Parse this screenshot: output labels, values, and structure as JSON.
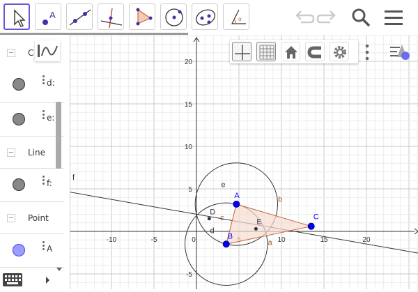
{
  "toolbar": {
    "tools": [
      {
        "name": "move-tool",
        "icon": "cursor-arrow-icon",
        "label_glyph": ""
      },
      {
        "name": "point-tool",
        "icon": "point-icon",
        "label_glyph": "A"
      },
      {
        "name": "line-tool",
        "icon": "line-through-points-icon",
        "label_glyph": ""
      },
      {
        "name": "perpendicular-line-tool",
        "icon": "perpendicular-line-icon",
        "label_glyph": ""
      },
      {
        "name": "polygon-tool",
        "icon": "polygon-icon",
        "label_glyph": ""
      },
      {
        "name": "circle-center-point-tool",
        "icon": "circle-icon",
        "label_glyph": ""
      },
      {
        "name": "conic-tool",
        "icon": "ellipse-icon",
        "label_glyph": ""
      },
      {
        "name": "angle-tool",
        "icon": "angle-icon",
        "label_glyph": "α"
      }
    ],
    "actions": [
      "undo-icon",
      "redo-icon",
      "search-icon",
      "menu-icon"
    ]
  },
  "algebra": {
    "header_icon": "algebra-view-graph-icon",
    "groups": [
      {
        "label": "C",
        "items": [
          {
            "label": "d:",
            "color": "#888888"
          },
          {
            "label": "e:",
            "color": "#888888"
          }
        ]
      },
      {
        "label": "Line",
        "items": [
          {
            "label": "f:",
            "color": "#888888"
          }
        ]
      },
      {
        "label": "Point",
        "items": [
          {
            "label": "A",
            "color": "#9d9dff"
          }
        ]
      }
    ]
  },
  "graphics_toolbar": {
    "buttons": [
      "axes-icon",
      "grid-icon",
      "home-icon",
      "magnet-icon",
      "gear-icon"
    ],
    "more": "more-vert-icon",
    "style": "style-bar-icon"
  },
  "colors": {
    "accent": "#6557d2",
    "point_blue": "#0000ff",
    "polygon_fill": "#f5dcd2",
    "polygon_stroke": "#c0693a",
    "label_brown": "#a0522d"
  },
  "graph": {
    "x_ticks": [
      "-10",
      "-5",
      "0",
      "5",
      "10",
      "15",
      "20"
    ],
    "y_ticks": [
      "20",
      "15",
      "10",
      "5",
      "-5"
    ],
    "points": [
      {
        "label": "A",
        "x": 4.7,
        "y": 3.2,
        "free": true
      },
      {
        "label": "B",
        "x": 3.5,
        "y": -1.5,
        "free": true
      },
      {
        "label": "C",
        "x": 13.5,
        "y": 0.6,
        "free": true
      },
      {
        "label": "D",
        "x": 1.5,
        "y": 1.5,
        "free": false
      },
      {
        "label": "E",
        "x": 7.0,
        "y": 0.3,
        "free": false
      }
    ],
    "segment_labels": {
      "a": "a",
      "b": "b",
      "c": "c"
    },
    "circle_labels": {
      "d": "d",
      "e": "e"
    },
    "line_label": "f"
  }
}
